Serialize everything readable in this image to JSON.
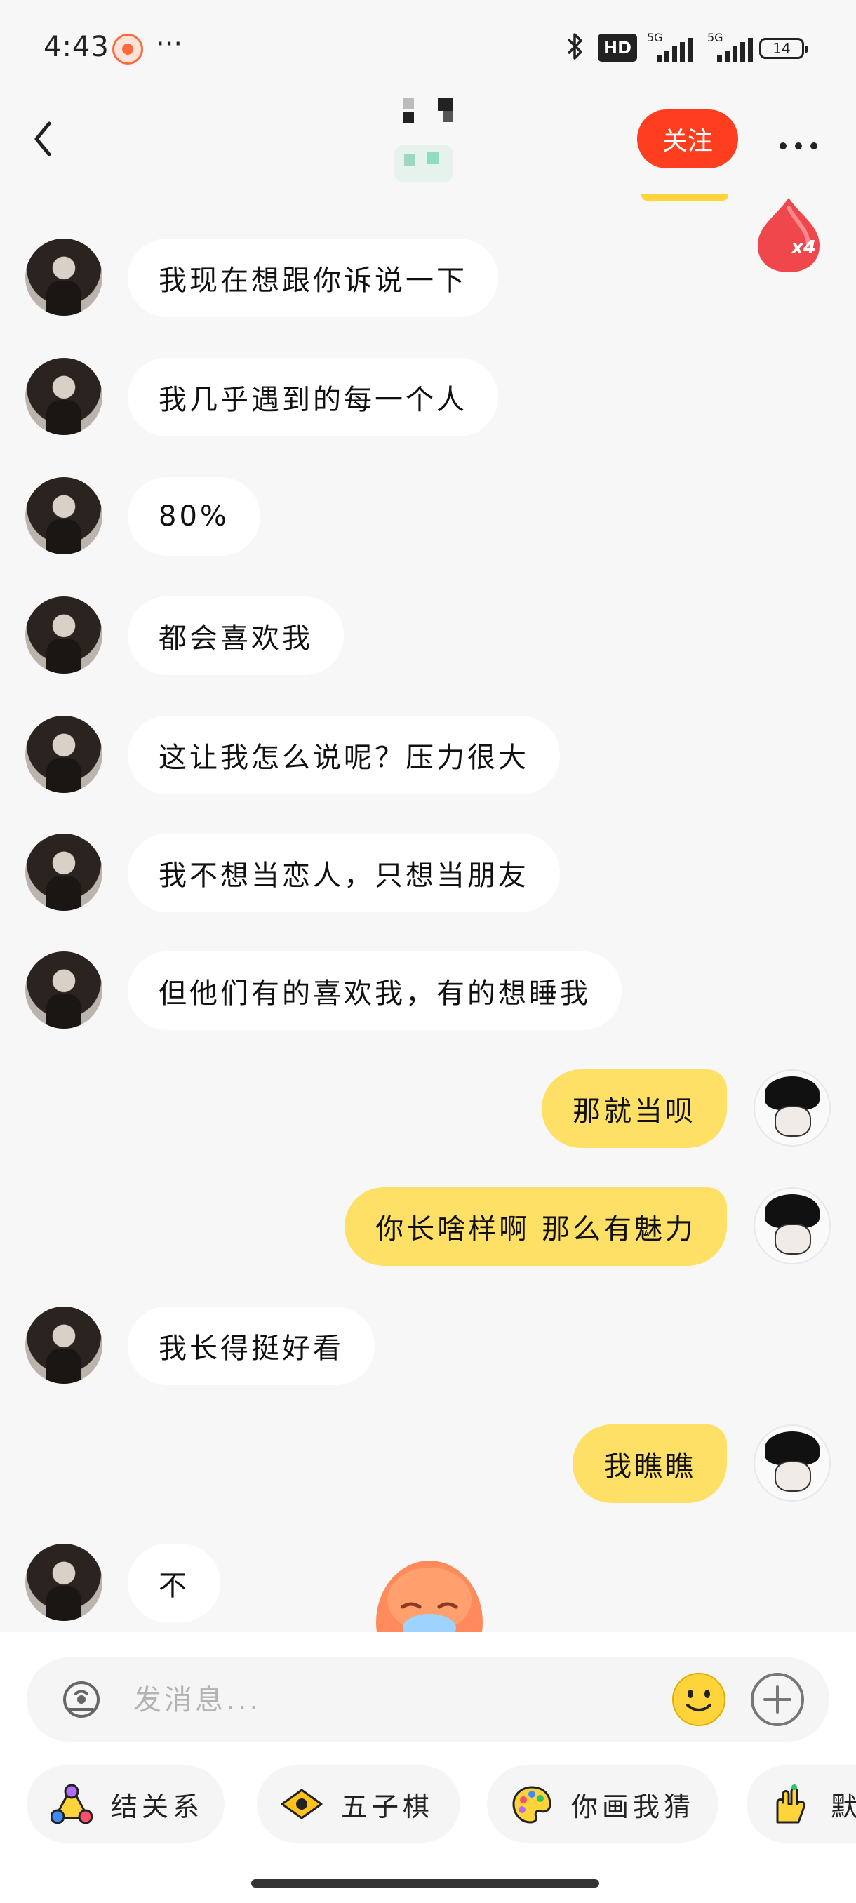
{
  "status_bar": {
    "time": "4:43",
    "overflow": "···",
    "hd_label": "HD",
    "network_1": "5G",
    "network_2": "5G",
    "battery": "14"
  },
  "header": {
    "back_icon": "chevron-left-icon",
    "follow_label": "关注",
    "more_icon": "more-icon",
    "accent_color": "#ff3d1f",
    "float_badge_text": "x4"
  },
  "messages": [
    {
      "side": "left",
      "text": "我现在想跟你诉说一下"
    },
    {
      "side": "left",
      "text": "我几乎遇到的每一个人"
    },
    {
      "side": "left",
      "text": "80%"
    },
    {
      "side": "left",
      "text": "都会喜欢我"
    },
    {
      "side": "left",
      "text": "这让我怎么说呢？压力很大"
    },
    {
      "side": "left",
      "text": "我不想当恋人，只想当朋友"
    },
    {
      "side": "left",
      "text": "但他们有的喜欢我，有的想睡我"
    },
    {
      "side": "right",
      "text": "那就当呗"
    },
    {
      "side": "right",
      "text": "你长啥样啊  那么有魅力"
    },
    {
      "side": "left",
      "text": "我长得挺好看"
    },
    {
      "side": "right",
      "text": "我瞧瞧"
    },
    {
      "side": "left",
      "text": "不"
    }
  ],
  "input": {
    "placeholder": "发消息...",
    "value": "",
    "voice_icon": "voice-icon",
    "emoji_icon": "emoji-smile-icon",
    "plus_icon": "plus-circle-icon"
  },
  "games": [
    {
      "label": "结关系",
      "icon": "relationship-icon"
    },
    {
      "label": "五子棋",
      "icon": "gomoku-icon"
    },
    {
      "label": "你画我猜",
      "icon": "palette-icon"
    },
    {
      "label": "默",
      "icon": "hands-icon"
    }
  ]
}
